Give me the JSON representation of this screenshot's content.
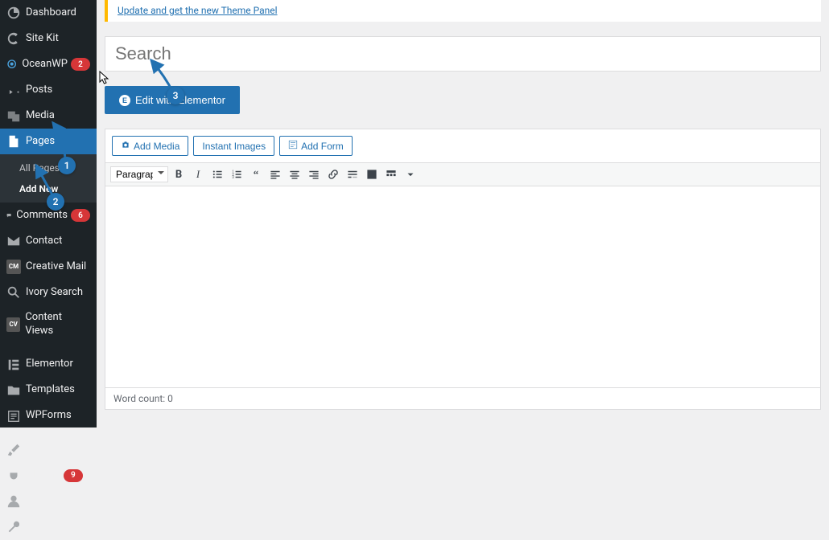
{
  "notice": {
    "link_text": "Update and get the new Theme Panel"
  },
  "title": {
    "placeholder": "Search"
  },
  "elementor": {
    "button_label": "Edit with Elementor"
  },
  "media_buttons": {
    "add_media": "Add Media",
    "instant_images": "Instant Images",
    "add_form": "Add Form"
  },
  "toolbar": {
    "format": "Paragraph"
  },
  "status": {
    "word_count": "Word count: 0"
  },
  "sidebar": {
    "dashboard": "Dashboard",
    "site_kit": "Site Kit",
    "oceanwp": "OceanWP",
    "oceanwp_badge": "2",
    "posts": "Posts",
    "media": "Media",
    "pages": "Pages",
    "all_pages": "All Pages",
    "add_new": "Add New",
    "comments": "Comments",
    "comments_badge": "6",
    "contact": "Contact",
    "creative_mail": "Creative Mail",
    "ivory_search": "Ivory Search",
    "content_views": "Content Views",
    "elementor": "Elementor",
    "templates": "Templates",
    "wpforms": "WPForms",
    "appearance": "Appearance",
    "plugins": "Plugins",
    "plugins_badge": "9",
    "users": "Users",
    "tools": "Tools"
  },
  "annotations": {
    "a1": "1",
    "a2": "2",
    "a3": "3"
  }
}
